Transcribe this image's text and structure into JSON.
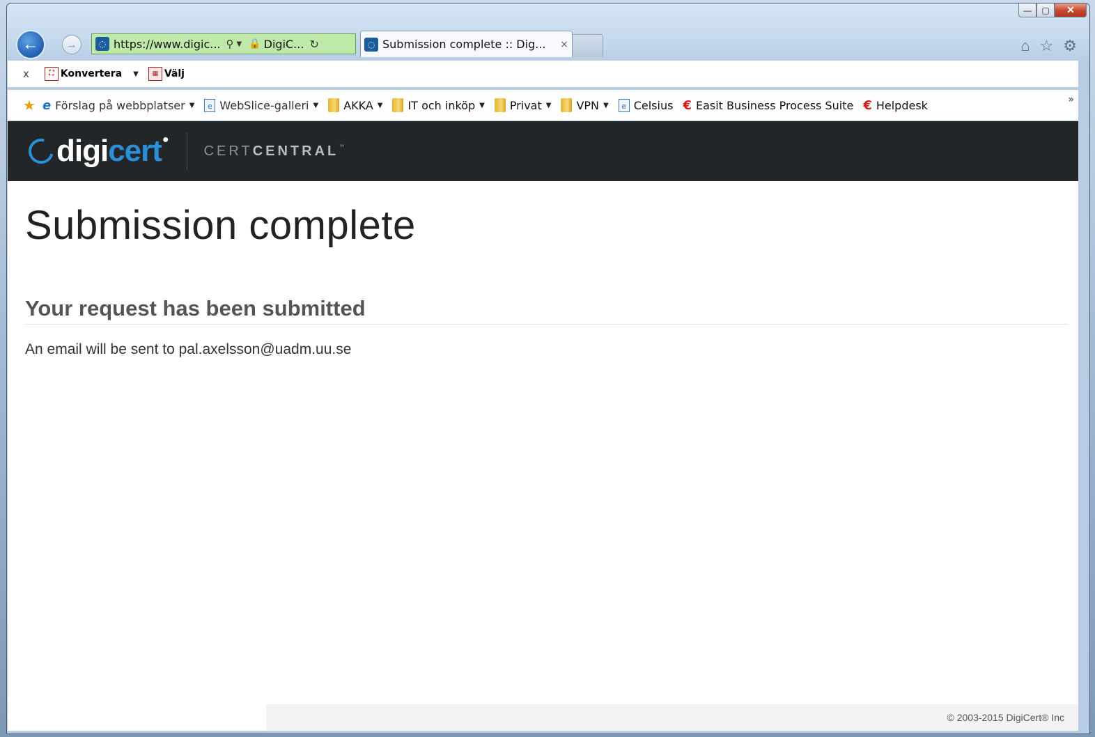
{
  "browser": {
    "address": {
      "scheme": "https://",
      "url_rest": "www.digic...",
      "cert_label": "DigiC..."
    },
    "tab": {
      "title": "Submission complete :: Dig...",
      "close": "×"
    },
    "right_icons": {
      "home": "⌂",
      "favorites": "☆",
      "settings": "⚙"
    },
    "window_buttons": {
      "minimize": "—",
      "maximize": "▢",
      "close": "✕"
    }
  },
  "command_bar": {
    "close": "x",
    "convert_label": "Konvertera",
    "select_label": "Välj"
  },
  "favorites_bar": {
    "items": [
      {
        "label": "Förslag på webbplatser",
        "icon": "ie-icon",
        "dropdown": true
      },
      {
        "label": "WebSlice-galleri",
        "icon": "page-icon",
        "dropdown": true
      },
      {
        "label": "AKKA",
        "icon": "folder-icon",
        "dropdown": true
      },
      {
        "label": "IT och inköp",
        "icon": "folder-icon",
        "dropdown": true
      },
      {
        "label": "Privat",
        "icon": "folder-icon",
        "dropdown": true
      },
      {
        "label": "VPN",
        "icon": "folder-icon",
        "dropdown": true
      },
      {
        "label": "Celsius",
        "icon": "page-icon",
        "dropdown": false
      },
      {
        "label": "Easit Business Process Suite",
        "icon": "easit-icon",
        "dropdown": false
      },
      {
        "label": "Helpdesk",
        "icon": "easit-icon",
        "dropdown": false
      }
    ],
    "more": "»"
  },
  "site": {
    "logo_digi": "digi",
    "logo_cert": "cert",
    "product_light": "CERT",
    "product_bold": "CENTRAL",
    "product_tm": "™",
    "brand_color": "#2b8fd6"
  },
  "page": {
    "title": "Submission complete",
    "subtitle": "Your request has been submitted",
    "note_prefix": "An email will be sent to ",
    "email": "pal.axelsson@uadm.uu.se",
    "footer": "© 2003-2015 DigiCert® Inc"
  }
}
